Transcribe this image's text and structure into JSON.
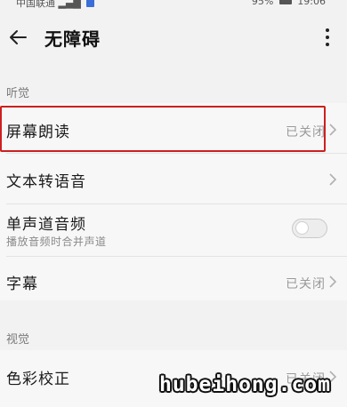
{
  "status_bar": {
    "carrier": "中国联通",
    "battery_pct": "95%",
    "time": "19:06"
  },
  "header": {
    "title": "无障碍"
  },
  "sections": [
    {
      "label": "听觉",
      "rows": [
        {
          "label": "屏幕朗读",
          "value": "已关闭",
          "highlighted": true
        },
        {
          "label": "文本转语音"
        },
        {
          "label": "单声道音频",
          "subtitle": "播放音频时合并声道",
          "toggle": "off"
        },
        {
          "label": "字幕",
          "value": "已关闭"
        }
      ]
    },
    {
      "label": "视觉",
      "rows": [
        {
          "label": "色彩校正",
          "value": "已关闭"
        }
      ]
    }
  ],
  "watermark": "hubeihong.com",
  "colors": {
    "highlight_border": "#cc1f1f",
    "background": "#f2f2f2",
    "secondary_text": "#9a9a9a"
  },
  "icons": {
    "back": "arrow-left-icon",
    "menu": "more-vertical-icon",
    "chevron": "chevron-right-icon"
  }
}
